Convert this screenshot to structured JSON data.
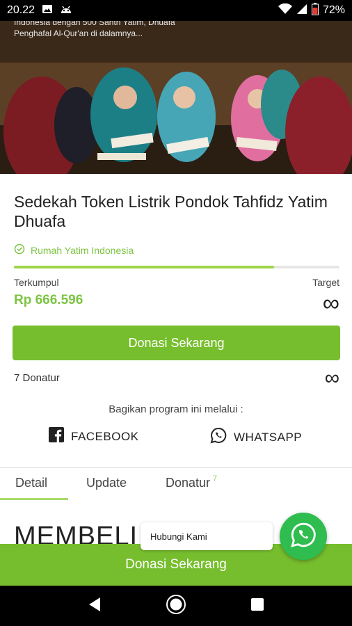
{
  "status_bar": {
    "time": "20.22",
    "battery": "72%"
  },
  "hero": {
    "caption_line1": "Indonesia dengan 500 Santri Yatim, Dhuafa",
    "caption_line2": "Penghafal Al-Qur'an di dalamnya..."
  },
  "campaign": {
    "title": "Sedekah Token Listrik Pondok Tahfidz Yatim Dhuafa",
    "organizer": "Rumah Yatim Indonesia",
    "progress_fraction": 0.8,
    "collected_label": "Terkumpul",
    "collected_amount": "Rp 666.596",
    "target_label": "Target",
    "target_value": "∞",
    "donate_button": "Donasi Sekarang",
    "donor_count": "7 Donatur",
    "donor_target": "∞"
  },
  "share": {
    "title": "Bagikan program ini melalui :",
    "facebook_label": "FACEBOOK",
    "whatsapp_label": "WHATSAPP"
  },
  "tabs": {
    "detail": "Detail",
    "update": "Update",
    "donatur": "Donatur",
    "donatur_count": "7"
  },
  "content": {
    "heading": "MEMBELI"
  },
  "chat": {
    "label": "Hubungi Kami"
  },
  "bottom_cta": {
    "label": "Donasi Sekarang"
  },
  "colors": {
    "accent": "#77be2e",
    "org_green": "#7cc442",
    "whatsapp": "#2ebd4e"
  }
}
